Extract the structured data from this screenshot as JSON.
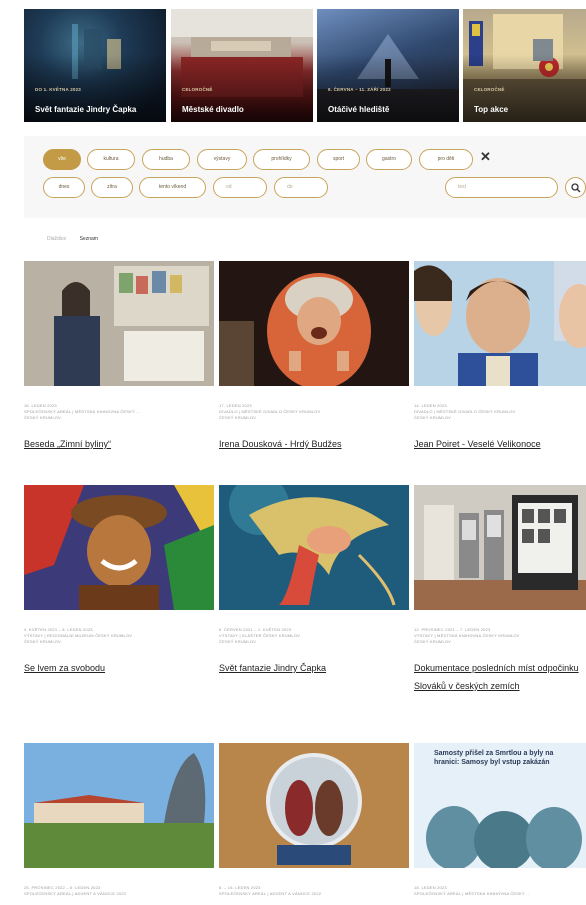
{
  "hero": [
    {
      "date": "do 1. května 2023",
      "title": "Svět fantazie Jindry Čapka"
    },
    {
      "date": "Celoročně",
      "title": "Městské divadlo"
    },
    {
      "date": "6. června – 11. září 2022",
      "title": "Otáčivé hlediště"
    },
    {
      "date": "Celoročně",
      "title": "Top akce"
    }
  ],
  "filters": {
    "categories": [
      "vše",
      "kultura",
      "hudba",
      "výstavy",
      "prohlídky",
      "sport",
      "gastro",
      "pro děti"
    ],
    "dates": [
      "dnes",
      "zítra",
      "tento víkend"
    ],
    "from_placeholder": "od",
    "to_placeholder": "do",
    "text_placeholder": "text",
    "close_symbol": "✕"
  },
  "view": {
    "tiles": "Dlaždice",
    "list": "Seznam"
  },
  "events": [
    {
      "date": "16. leden 2023",
      "venue": "Společenský areál | Městská knihovna Český ...",
      "city": "Český Krumlov",
      "title": "Beseda „Zimní byliny“"
    },
    {
      "date": "17. leden 2023",
      "venue": "Divadlo | Městské divadlo Český Krumlov",
      "city": "Český Krumlov",
      "title": "Irena Dousková - Hrdý Budžes"
    },
    {
      "date": "14. leden 2023",
      "venue": "Divadlo | Městské divadlo Český Krumlov",
      "city": "Český Krumlov",
      "title": "Jean Poiret - Veselé Velikonoce"
    },
    {
      "date": "4. květen 2021 – 8. leden 2023",
      "venue": "Výstavy | Regionální muzeum Český Krumlov",
      "city": "Český Krumlov",
      "title": "Se lvem za svobodu"
    },
    {
      "date": "6. červen 2021 – 1. květen 2023",
      "venue": "Výstavy | Klášter Český Krumlov",
      "city": "Český Krumlov",
      "title": "Svět fantazie Jindry Čapka"
    },
    {
      "date": "12. prosinec 2021 – 7. leden 2023",
      "venue": "Výstavy | Městská knihovna Český Krumlov",
      "city": "Český Krumlov",
      "title": "Dokumentace posledních míst odpočinku Slováků v českých zemích"
    },
    {
      "date": "25. prosinec 2022 – 6. leden 2023",
      "venue": "Společenský areál | Advent a Vánoce 2022",
      "city": "",
      "title": ""
    },
    {
      "date": "8. – 16. leden 2023",
      "venue": "Společenský areál | Advent a Vánoce 2022",
      "city": "",
      "title": ""
    },
    {
      "date": "18. leden 2023",
      "venue": "Společenský areál | Městská knihovna Český ...",
      "city": "",
      "title": ""
    }
  ],
  "poster_text": "Samosty přišel za Smrtlou a byly na hranici: Samosy byl vstup zakázán"
}
